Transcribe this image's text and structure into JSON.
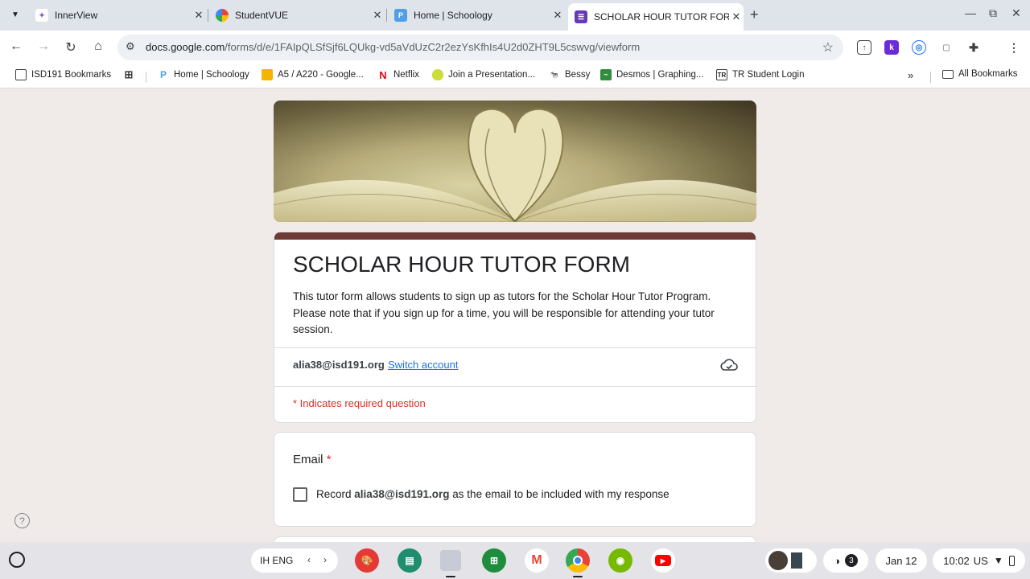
{
  "browser": {
    "tabs": [
      {
        "title": "InnerView",
        "favicon_color": "#7e57c2",
        "active": false
      },
      {
        "title": "StudentVUE",
        "favicon_color": "#e8453c",
        "active": false
      },
      {
        "title": "Home | Schoology",
        "favicon_color": "#4fa0e5",
        "active": false
      },
      {
        "title": "SCHOLAR HOUR TUTOR FORM",
        "favicon_color": "#673ab7",
        "active": true
      }
    ],
    "url_domain": "docs.google.com",
    "url_path": "/forms/d/e/1FAIpQLSfSjf6LQUkg-vd5aVdUzC2r2ezYsKfhIs4U2d0ZHT9L5cswvg/viewform",
    "bookmarks": [
      {
        "label": "ISD191 Bookmarks",
        "icon": "folder-icon"
      },
      {
        "label": "Home | Schoology",
        "icon": "schoology-icon"
      },
      {
        "label": "A5 / A220 - Google...",
        "icon": "slides-icon"
      },
      {
        "label": "Netflix",
        "icon": "netflix-icon"
      },
      {
        "label": "Join a Presentation...",
        "icon": "pear-icon"
      },
      {
        "label": "Bessy",
        "icon": "bessy-icon"
      },
      {
        "label": "Desmos | Graphing...",
        "icon": "desmos-icon"
      },
      {
        "label": "TR Student Login",
        "icon": "tr-icon"
      }
    ],
    "more_bookmarks": "»",
    "all_bookmarks": "All Bookmarks"
  },
  "form": {
    "title": "SCHOLAR HOUR TUTOR FORM",
    "description": "This tutor form allows students to sign up as tutors for the Scholar Hour Tutor Program. Please note that if you sign up for a time, you will be responsible for attending your tutor session.",
    "account_email": "alia38@isd191.org",
    "switch_account": "Switch account",
    "required_note": "* Indicates required question",
    "theme_color": "#6e3a35",
    "email_question": {
      "label": "Email",
      "required_mark": "*",
      "checkbox_prefix": "Record",
      "checkbox_email": "alia38@isd191.org",
      "checkbox_suffix": "as the email to be included with my response",
      "checked": false
    }
  },
  "shelf": {
    "ime_label": "IH ENG",
    "apps": [
      "canvas-icon",
      "classroom-icon",
      "files-icon",
      "sheets-icon",
      "gmail-icon",
      "chrome-icon",
      "nvidia-icon",
      "youtube-icon"
    ],
    "notification_count": "3",
    "date": "Jan 12",
    "time": "10:02",
    "locale": "US"
  }
}
